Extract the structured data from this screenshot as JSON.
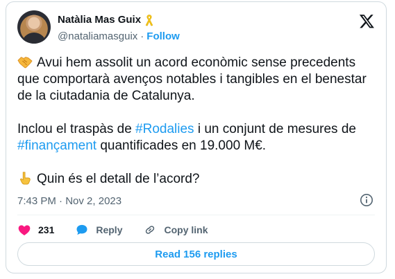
{
  "author": {
    "display_name": "Natàlia Mas Guix",
    "handle": "@nataliamasguix",
    "separator": "·",
    "follow_label": "Follow",
    "badge_icon": "yellow-ribbon-icon"
  },
  "platform_logo": "x-logo-icon",
  "tweet": {
    "line1_emoji": "handshake-icon",
    "paragraph1": "Avui hem assolit un acord econòmic sense precedents que comportarà avenços notables i tangibles en el benestar de la ciutadania de Catalunya.",
    "p2_text1": "Inclou el traspàs de ",
    "p2_hashtag1": "#Rodalies",
    "p2_text2": " i un conjunt de mesures de ",
    "p2_hashtag2": "#finançament",
    "p2_text3": " quantificades en 19.000 M€.",
    "line3_emoji": "pointing-down-icon",
    "paragraph3": "Quin és el detall de l’acord?"
  },
  "timestamp": {
    "time": "7:43 PM",
    "separator": "·",
    "date": "Nov 2, 2023"
  },
  "actions": {
    "likes_count": "231",
    "reply_label": "Reply",
    "copy_link_label": "Copy link"
  },
  "read_replies_label": "Read 156 replies",
  "colors": {
    "accent": "#1d9bf0",
    "like": "#f91880",
    "text": "#0f1419",
    "secondary_text": "#536471",
    "border": "#cfd9de"
  }
}
